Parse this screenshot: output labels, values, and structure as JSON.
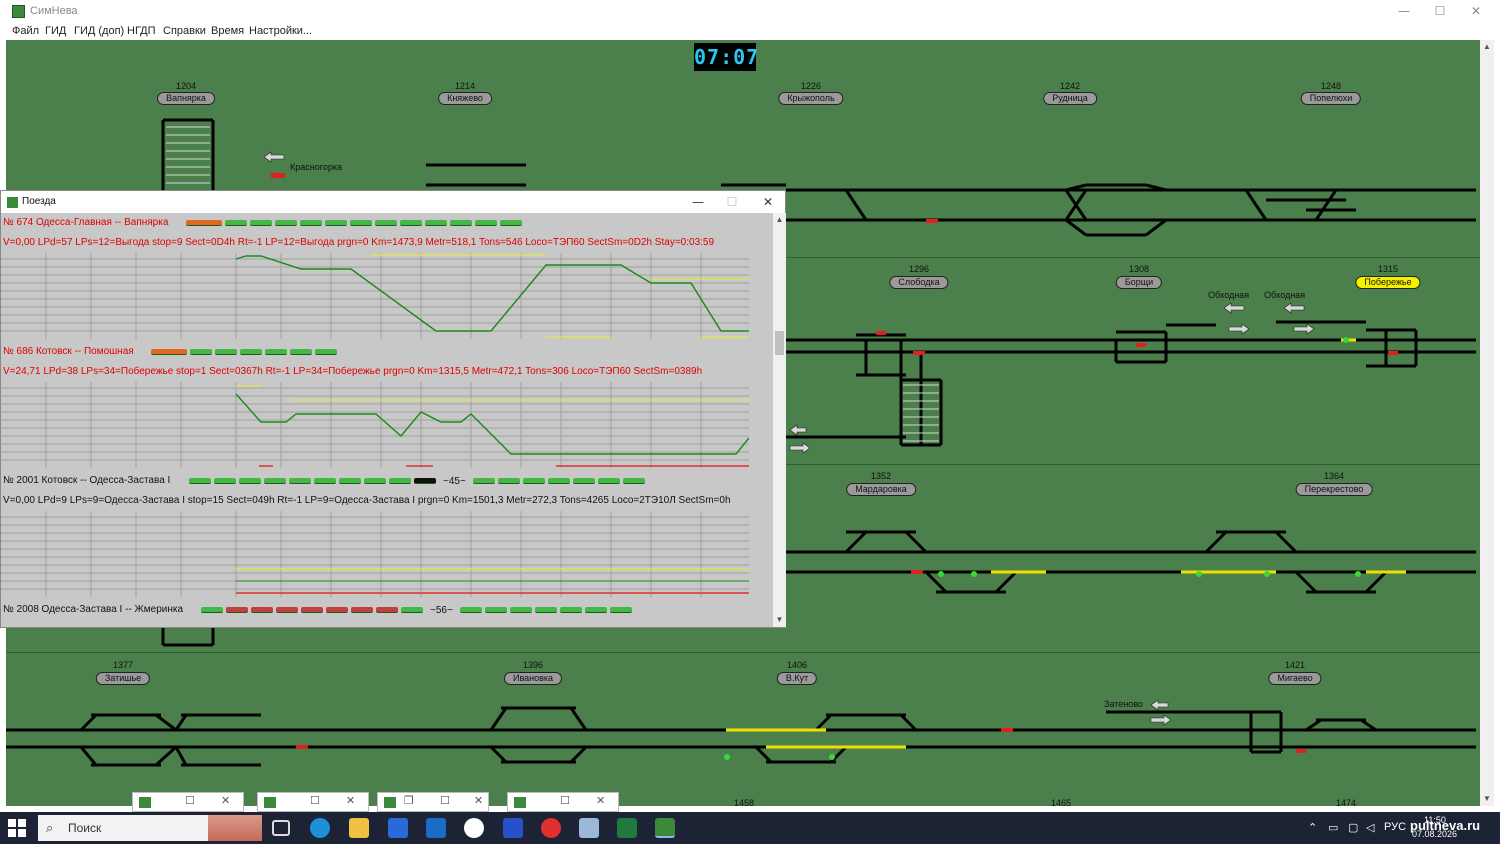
{
  "window": {
    "title": "СимНева",
    "controls": {
      "minimize": "—",
      "maximize": "☐",
      "close": "✕"
    }
  },
  "menu": {
    "items": [
      "Файл",
      "ГИД",
      "ГИД (доп)",
      "НГДП",
      "Справки",
      "Время",
      "Настройки..."
    ]
  },
  "clock": {
    "value": "07:07"
  },
  "stations": [
    {
      "num": "1204",
      "name": "Вапнярка"
    },
    {
      "num": "1214",
      "name": "Княжево"
    },
    {
      "num": "1226",
      "name": "Крыжополь"
    },
    {
      "num": "1242",
      "name": "Рудница"
    },
    {
      "num": "1248",
      "name": "Попелюхи"
    },
    {
      "num": "1296",
      "name": "Слободка"
    },
    {
      "num": "1308",
      "name": "Борщи"
    },
    {
      "num": "1315",
      "name": "Побережье",
      "active": true
    },
    {
      "num": "1352",
      "name": "Мардаровка"
    },
    {
      "num": "1364",
      "name": "Перекрестово"
    },
    {
      "num": "1377",
      "name": "Затишье"
    },
    {
      "num": "1396",
      "name": "Ивановка"
    },
    {
      "num": "1406",
      "name": "В.Кут"
    },
    {
      "num": "1421",
      "name": "Мигаево"
    }
  ],
  "bottom_station_nums": [
    "1458",
    "1465",
    "1474"
  ],
  "road_labels": {
    "krasnogorka": "Красногорка",
    "obkhodnaya1": "Обходная",
    "obkhodnaya2": "Обходная",
    "zatenovo": "Затеново"
  },
  "trains_window": {
    "title": "Поезда",
    "controls": {
      "minimize": "—",
      "maximize": "☐",
      "close": "✕"
    },
    "trains": [
      {
        "header": "№ 674 Одесса-Главная -- Вапнярка",
        "stats": "V=0,00 LPd=57 LPs=12=Выгода stop=9 Sect=0D4h Rt=-1 LP=12=Выгода prgn=0 Km=1473,9 Metr=518,1 Tons=546 Loco=ТЭП60 SectSm=0D2h Stay=0:03:59",
        "color": "red"
      },
      {
        "header": "№ 686 Котовск -- Помошная",
        "stats": "V=24,71 LPd=38 LPs=34=Побережье stop=1 Sect=0367h Rt=-1 LP=34=Побережье prgn=0 Km=1315,5 Metr=472,1 Tons=306 Loco=ТЭП60 SectSm=0389h",
        "color": "red"
      },
      {
        "header": "№ 2001 Котовск -- Одесса-Застава I",
        "stats": "V=0,00 LPd=9 LPs=9=Одесса-Застава I stop=15 Sect=049h Rt=-1 LP=9=Одесса-Застава I prgn=0 Km=1501,3 Metr=272,3 Tons=4265 Loco=2ТЭ10Л SectSm=0h",
        "gap": "~45~",
        "color": "dark"
      },
      {
        "header": "№ 2008 Одесса-Застава I -- Жмеринка",
        "gap": "~56~",
        "color": "dark"
      }
    ]
  },
  "taskbar": {
    "search_placeholder": "Поиск",
    "language": "РУС",
    "time": "11:50",
    "date": "07.08.2026"
  },
  "watermark": "pultneva.ru",
  "colors": {
    "schema_bg": "#4b7f4b",
    "track": "#000000",
    "occupied": "#f0e000",
    "signal_red": "#e02020",
    "active_station": "#f5f000"
  }
}
